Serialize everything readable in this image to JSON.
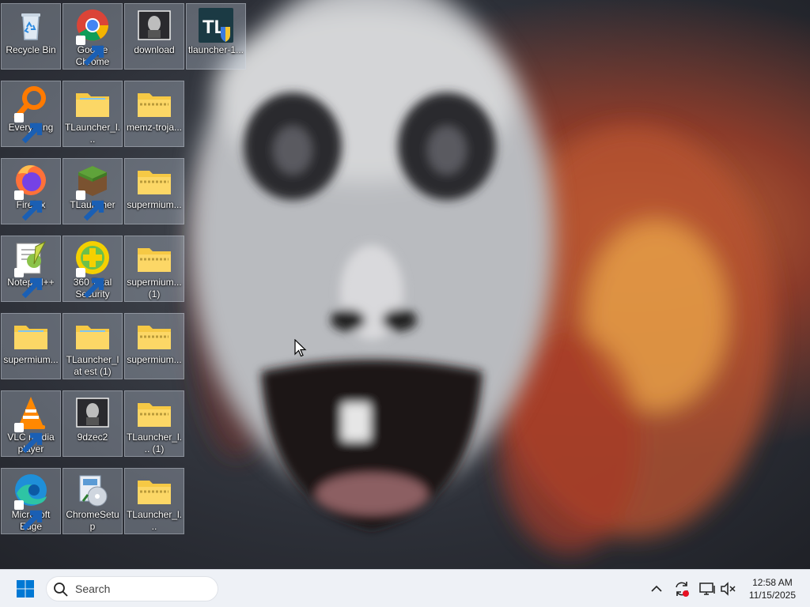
{
  "desktop": {
    "icons": [
      {
        "label": "Recycle Bin",
        "icon": "recycle-bin-icon"
      },
      {
        "label": "Google Chrome",
        "icon": "chrome-icon"
      },
      {
        "label": "download",
        "icon": "image-thumbnail-icon"
      },
      {
        "label": "tlauncher-1...",
        "icon": "tlauncher-installer-icon"
      },
      {
        "label": "Everything",
        "icon": "everything-search-icon"
      },
      {
        "label": "TLauncher_l...",
        "icon": "folder-icon"
      },
      {
        "label": "memz-troja...",
        "icon": "zip-folder-icon"
      },
      {
        "label": "Firefox",
        "icon": "firefox-icon"
      },
      {
        "label": "TLauncher",
        "icon": "minecraft-block-icon"
      },
      {
        "label": "supermium...",
        "icon": "zip-folder-icon"
      },
      {
        "label": "Notepad++",
        "icon": "notepad-plus-plus-icon"
      },
      {
        "label": "360 Total Security",
        "icon": "360-total-security-icon"
      },
      {
        "label": "supermium... (1)",
        "icon": "zip-folder-icon"
      },
      {
        "label": "supermium...",
        "icon": "folder-icon"
      },
      {
        "label": "TLauncher_lat est (1)",
        "icon": "folder-icon"
      },
      {
        "label": "supermium...",
        "icon": "zip-folder-icon"
      },
      {
        "label": "VLC media player",
        "icon": "vlc-icon"
      },
      {
        "label": "9dzec2",
        "icon": "image-thumbnail-icon"
      },
      {
        "label": "TLauncher_l... (1)",
        "icon": "zip-folder-icon"
      },
      {
        "label": "Microsoft Edge",
        "icon": "edge-icon"
      },
      {
        "label": "ChromeSetup",
        "icon": "installer-icon"
      },
      {
        "label": "TLauncher_l...",
        "icon": "zip-folder-icon"
      }
    ]
  },
  "taskbar": {
    "search_placeholder": "Search",
    "time": "12:58 AM",
    "date": "11/15/2025"
  },
  "colors": {
    "taskbar_bg": "#eef1f6",
    "start_blue": "#0078d4",
    "folder_yellow": "#f6c945"
  }
}
